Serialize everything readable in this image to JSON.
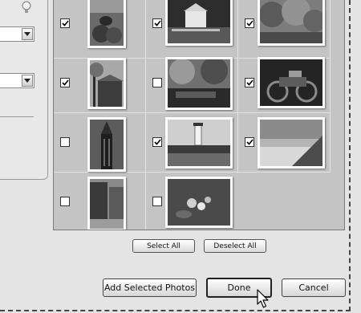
{
  "buttons": {
    "select_all": "Select All",
    "deselect_all": "Deselect All",
    "add_selected": "Add Selected Photos",
    "done": "Done",
    "cancel": "Cancel"
  },
  "photos": [
    {
      "subject": "pumpkins",
      "checked": true
    },
    {
      "subject": "white farmhouse",
      "checked": true
    },
    {
      "subject": "autumn trees",
      "checked": true
    },
    {
      "subject": "barn with tree",
      "checked": true
    },
    {
      "subject": "pond with foliage",
      "checked": false
    },
    {
      "subject": "motorcycle",
      "checked": true
    },
    {
      "subject": "skyscraper",
      "checked": false
    },
    {
      "subject": "lighthouse harbor",
      "checked": true
    },
    {
      "subject": "beach dunes",
      "checked": true
    },
    {
      "subject": "city street",
      "checked": false
    },
    {
      "subject": "water lilies",
      "checked": false
    }
  ],
  "icons": {
    "tip": "lightbulb-icon",
    "dropdown": "chevron-down-icon",
    "checkmark": "checkmark-icon",
    "scroll_down": "scroll-down-arrow-icon",
    "pointer": "mouse-pointer-icon"
  },
  "colors": {
    "grid_background": "#c4c4c4",
    "window_background": "#e4e4e4"
  }
}
